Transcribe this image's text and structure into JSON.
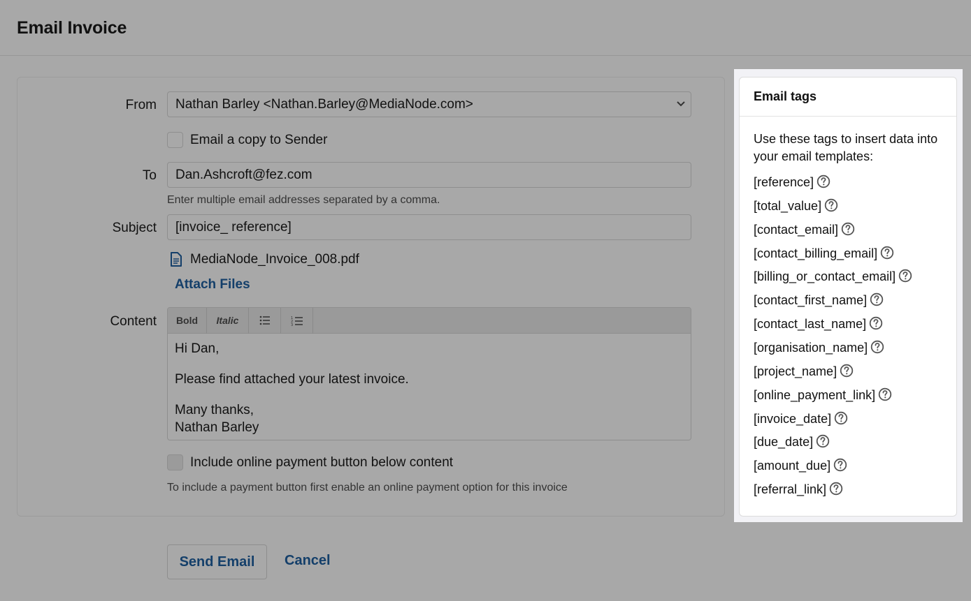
{
  "header": {
    "title": "Email Invoice"
  },
  "form": {
    "from_label": "From",
    "from_value": "Nathan Barley <Nathan.Barley@MediaNode.com>",
    "copy_label": "Email a copy to Sender",
    "to_label": "To",
    "to_value": "Dan.Ashcroft@fez.com",
    "to_help": "Enter multiple email addresses separated by a comma.",
    "subject_label": "Subject",
    "subject_value": "[invoice_ reference]",
    "attachment": "MediaNode_Invoice_008.pdf",
    "attach_link": "Attach Files",
    "content_label": "Content",
    "toolbar": {
      "bold": "Bold",
      "italic": "Italic"
    },
    "content_lines": [
      "Hi Dan,",
      "Please find attached your latest invoice.",
      "Many thanks,",
      "Nathan Barley"
    ],
    "payment_label": "Include online payment button below content",
    "payment_help": "To include a payment button first enable an online payment option for this invoice"
  },
  "actions": {
    "send": "Send Email",
    "cancel": "Cancel"
  },
  "tags_panel": {
    "title": "Email tags",
    "intro": "Use these tags to insert data into your email templates:",
    "tags": [
      "[reference]",
      "[total_value]",
      "[contact_email]",
      "[contact_billing_email]",
      "[billing_or_contact_email]",
      "[contact_first_name]",
      "[contact_last_name]",
      "[organisation_name]",
      "[project_name]",
      "[online_payment_link]",
      "[invoice_date]",
      "[due_date]",
      "[amount_due]",
      "[referral_link]"
    ]
  },
  "colors": {
    "link": "#143f6a",
    "overlay_bg": "#a8a8a8",
    "panel_bg": "#ffffff"
  },
  "icons": [
    "chevron-down-icon",
    "document-icon",
    "bullet-list-icon",
    "numbered-list-icon",
    "help-circle-icon"
  ]
}
